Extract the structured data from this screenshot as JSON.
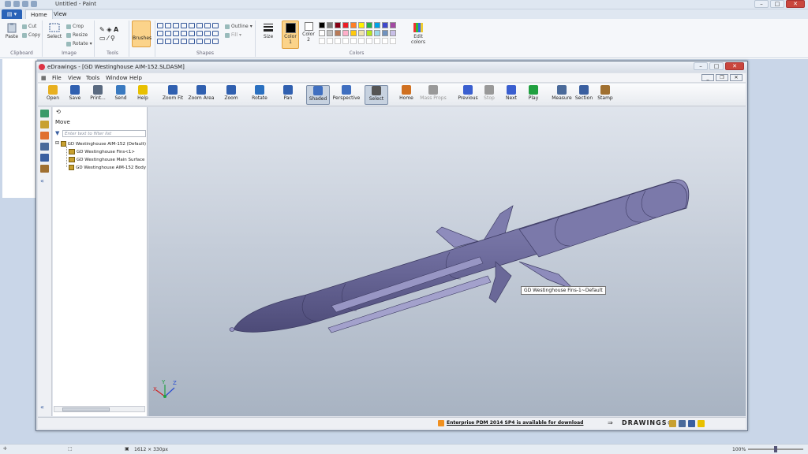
{
  "paint": {
    "title": "Untitled - Paint",
    "file_button": "",
    "tabs": [
      "Home",
      "View"
    ],
    "clipboard": {
      "paste": "Paste",
      "cut": "Cut",
      "copy": "Copy",
      "label": "Clipboard"
    },
    "image": {
      "select": "Select",
      "crop": "Crop",
      "resize": "Resize",
      "rotate": "Rotate",
      "label": "Image"
    },
    "tools": {
      "label": "Tools"
    },
    "brushes": "Brushes",
    "shapes": {
      "outline": "Outline",
      "fill": "Fill",
      "label": "Shapes"
    },
    "size": "Size",
    "color1": "Color 1",
    "color2": "Color 2",
    "colors_label": "Colors",
    "edit_colors": "Edit colors",
    "palette_top": [
      "#000000",
      "#7f7f7f",
      "#880015",
      "#ed1c24",
      "#ff7f27",
      "#fff200",
      "#22b14c",
      "#00a2e8",
      "#3f48cc",
      "#a349a4"
    ],
    "palette_bottom": [
      "#ffffff",
      "#c3c3c3",
      "#b97a57",
      "#ffaec9",
      "#ffc90e",
      "#efe4b0",
      "#b5e61d",
      "#99d9ea",
      "#7092be",
      "#c8bfe7"
    ],
    "status_dims": "1612 × 330px",
    "zoom": "100%"
  },
  "edrawings": {
    "title": "eDrawings - [GD Westinghouse AIM-152.SLDASM]",
    "menu": [
      "File",
      "View",
      "Tools",
      "Window",
      "Help"
    ],
    "toolbar": [
      {
        "label": "Open",
        "icon": "folder-icon"
      },
      {
        "label": "Save",
        "icon": "save-icon"
      },
      {
        "label": "Print...",
        "icon": "print-icon"
      },
      {
        "label": "Send",
        "icon": "send-icon"
      },
      {
        "label": "Help",
        "icon": "help-icon"
      },
      {
        "label": "Zoom Fit",
        "icon": "zoom-fit-icon"
      },
      {
        "label": "Zoom Area",
        "icon": "zoom-area-icon"
      },
      {
        "label": "Zoom",
        "icon": "zoom-icon"
      },
      {
        "label": "Rotate",
        "icon": "rotate-icon"
      },
      {
        "label": "Pan",
        "icon": "pan-icon"
      },
      {
        "label": "Shaded",
        "icon": "shaded-icon"
      },
      {
        "label": "Perspective",
        "icon": "perspective-icon"
      },
      {
        "label": "Select",
        "icon": "select-icon"
      },
      {
        "label": "Home",
        "icon": "home-icon"
      },
      {
        "label": "Mass Props",
        "icon": "mass-props-icon"
      },
      {
        "label": "Previous",
        "icon": "previous-icon"
      },
      {
        "label": "Stop",
        "icon": "stop-icon"
      },
      {
        "label": "Next",
        "icon": "next-icon"
      },
      {
        "label": "Play",
        "icon": "play-icon"
      },
      {
        "label": "Measure",
        "icon": "measure-icon"
      },
      {
        "label": "Section",
        "icon": "section-icon"
      },
      {
        "label": "Stamp",
        "icon": "stamp-icon"
      }
    ],
    "panel": {
      "title": "Move",
      "filter_placeholder": "Enter text to filter list",
      "tree": [
        "GD Westinghouse AIM-152 (Default)",
        "GD Westinghouse Fins<1>",
        "GD Westinghouse Main Surface",
        "GD Westinghouse AIM-152 Body"
      ]
    },
    "tooltip": "GD Westinghouse Fins-1~Default",
    "status_message": "Enterprise PDM 2014 SP4 is available for download",
    "brand": "DRAWINGS®",
    "axes": {
      "x": "X",
      "y": "Y",
      "z": "Z"
    }
  }
}
